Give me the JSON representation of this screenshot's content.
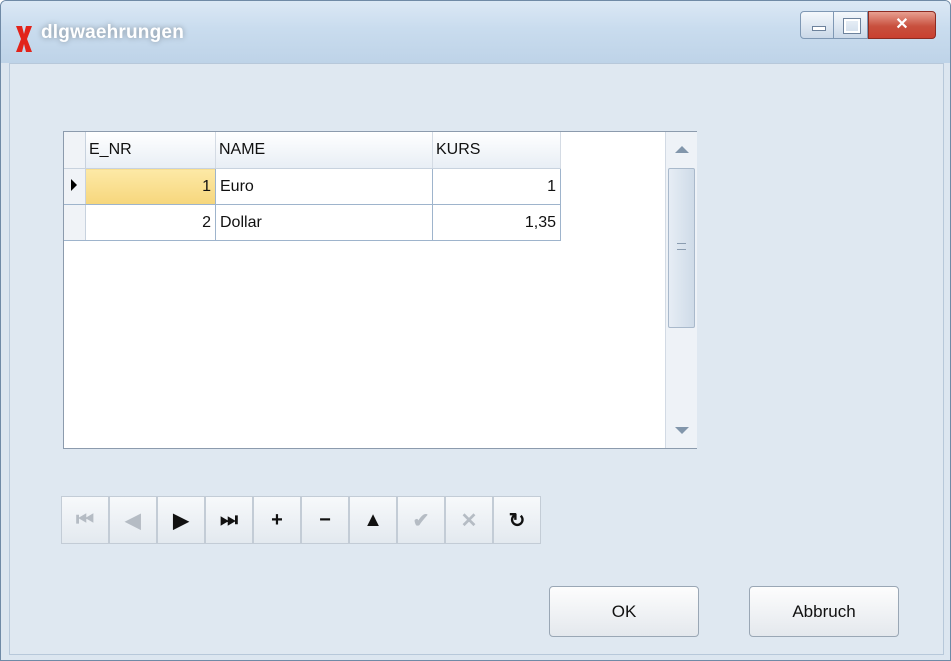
{
  "window": {
    "title": "dlgwaehrungen",
    "controls": {
      "minimize": "minimize",
      "maximize": "maximize",
      "close": "✕"
    }
  },
  "grid": {
    "columns": [
      "E_NR",
      "NAME",
      "KURS"
    ],
    "rows": [
      {
        "E_NR": "1",
        "NAME": "Euro",
        "KURS": "1"
      },
      {
        "E_NR": "2",
        "NAME": "Dollar",
        "KURS": "1,35"
      }
    ],
    "current_row": 0
  },
  "navigator": {
    "buttons": [
      {
        "name": "first",
        "glyph": "⏮",
        "enabled": false
      },
      {
        "name": "prior",
        "glyph": "◀",
        "enabled": false
      },
      {
        "name": "next",
        "glyph": "▶",
        "enabled": true
      },
      {
        "name": "last",
        "glyph": "⏭",
        "enabled": true
      },
      {
        "name": "insert",
        "glyph": "+",
        "enabled": true
      },
      {
        "name": "delete",
        "glyph": "−",
        "enabled": true
      },
      {
        "name": "edit",
        "glyph": "▲",
        "enabled": true
      },
      {
        "name": "post",
        "glyph": "✔",
        "enabled": false
      },
      {
        "name": "cancel",
        "glyph": "✕",
        "enabled": false
      },
      {
        "name": "refresh",
        "glyph": "↻",
        "enabled": true
      }
    ]
  },
  "buttons": {
    "ok": "OK",
    "cancel": "Abbruch"
  },
  "colors": {
    "title_bar": "#c9dcee",
    "client": "#dfe8f1",
    "selected_cell": "#f6d67c",
    "close_button": "#c94030"
  }
}
